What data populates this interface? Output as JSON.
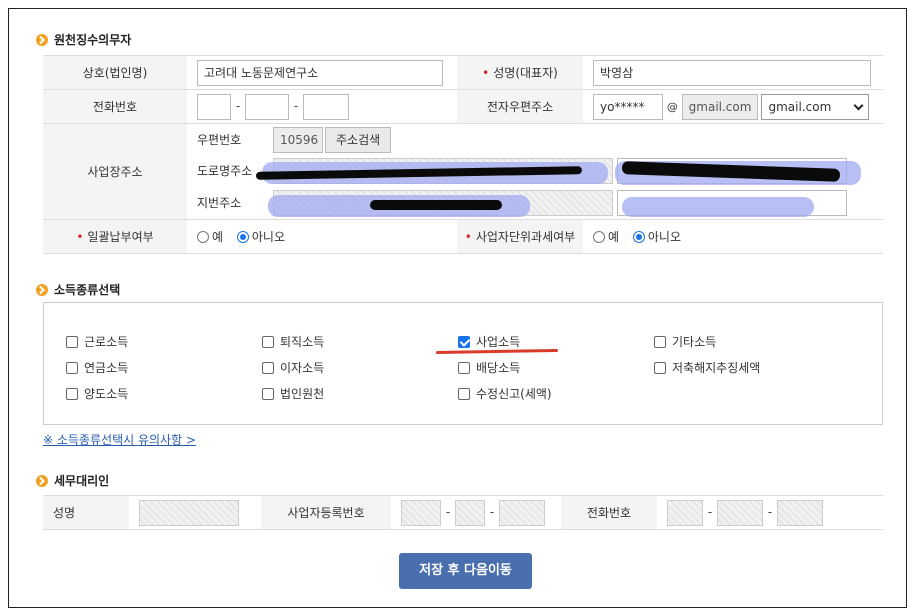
{
  "withholder": {
    "section_title": "원천징수의무자",
    "company_label": "상호(법인명)",
    "company_value": "고려대 노동문제연구소",
    "rep_label": "성명(대표자)",
    "rep_value": "박영삼",
    "phone_label": "전화번호",
    "email_label": "전자우편주소",
    "email_user": "yo*****",
    "email_at": "@",
    "email_domain": "gmail.com",
    "email_select": "gmail.com",
    "addr_label": "사업장주소",
    "zip_label": "우편번호",
    "zip_value": "10596",
    "addr_search_button": "주소검색",
    "road_label": "도로명주소",
    "lot_label": "지번주소",
    "lump_label": "일괄납부여부",
    "unit_tax_label": "사업자단위과세여부",
    "yes": "예",
    "no": "아니오"
  },
  "income": {
    "section_title": "소득종류선택",
    "items": [
      {
        "label": "근로소득",
        "checked": false
      },
      {
        "label": "퇴직소득",
        "checked": false
      },
      {
        "label": "사업소득",
        "checked": true
      },
      {
        "label": "기타소득",
        "checked": false
      },
      {
        "label": "연금소득",
        "checked": false
      },
      {
        "label": "이자소득",
        "checked": false
      },
      {
        "label": "배당소득",
        "checked": false
      },
      {
        "label": "저축해지추징세액",
        "checked": false
      },
      {
        "label": "양도소득",
        "checked": false
      },
      {
        "label": "법인원천",
        "checked": false
      },
      {
        "label": "수정신고(세액)",
        "checked": false
      }
    ],
    "notice_link": "※ 소득종류선택시 유의사항 >"
  },
  "agent": {
    "section_title": "세무대리인",
    "name_label": "성명",
    "bizno_label": "사업자등록번호",
    "phone_label": "전화번호"
  },
  "actions": {
    "save_next": "저장 후 다음이동"
  },
  "colors": {
    "accent": "#1a73e8",
    "button": "#4a6fae",
    "bullet": "#f0a022",
    "marker": "#d93a2a"
  }
}
